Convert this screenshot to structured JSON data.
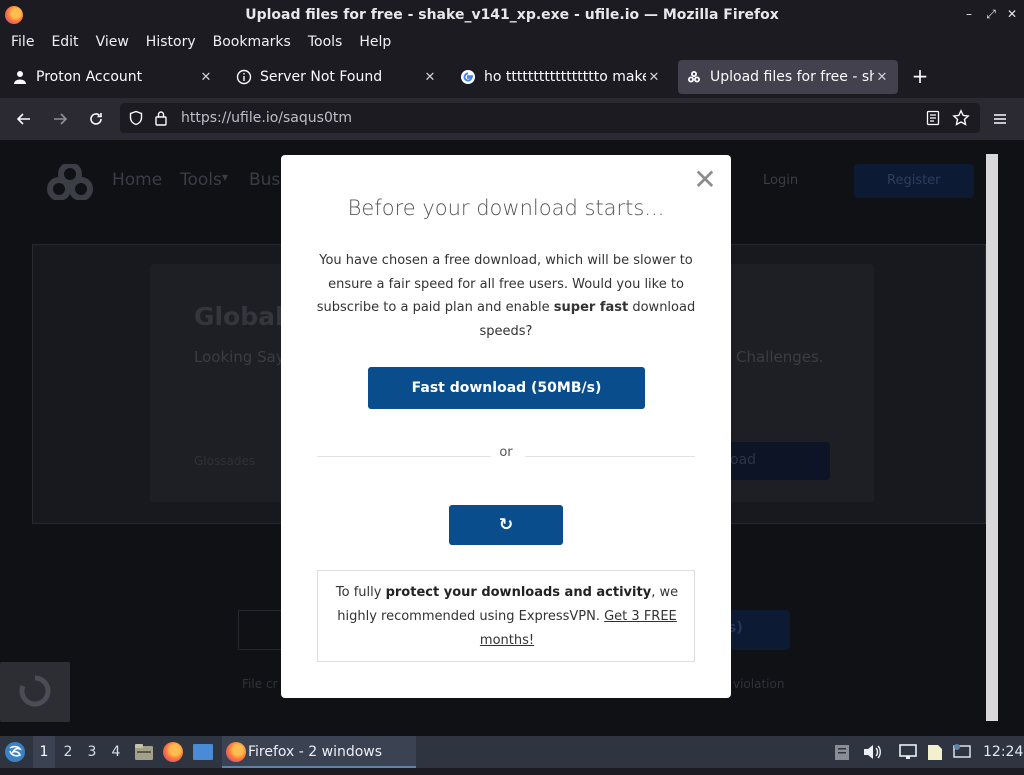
{
  "window": {
    "title": "Upload files for free - shake_v141_xp.exe - ufile.io — Mozilla Firefox",
    "controls": [
      "–",
      "⤢",
      "✕"
    ]
  },
  "menu": [
    "File",
    "Edit",
    "View",
    "History",
    "Bookmarks",
    "Tools",
    "Help"
  ],
  "tabs": [
    {
      "label": "Proton Account",
      "icon": "person-icon",
      "active": false
    },
    {
      "label": "Server Not Found",
      "icon": "info-icon",
      "active": false
    },
    {
      "label": "ho ttttttttttttttttto make",
      "icon": "google-icon",
      "active": false
    },
    {
      "label": "Upload files for free - sha",
      "icon": "ufile-icon",
      "active": true
    }
  ],
  "newtab_label": "+",
  "navbar": {
    "url_host": "https://ufile.io",
    "url_path": "/saqus0tm"
  },
  "site": {
    "nav": [
      "Home",
      "Tools",
      "Bus"
    ],
    "login": "Login",
    "register": "Register",
    "hero_title": "Global",
    "hero_sub_left": "Looking Say",
    "hero_sub_right": "Challenges.",
    "hero_btn": "oad",
    "hero_foot": "Glossades",
    "bottom_btn": "s)",
    "footer_left": "File cr",
    "footer_right": "violation"
  },
  "modal": {
    "title": "Before your download starts...",
    "desc_1": "You have chosen a free download, which will be slower to ensure a fair speed for all free users. Would you like to subscribe to a paid plan and enable ",
    "desc_bold": "super fast",
    "desc_2": " download speeds?",
    "fast_button": "Fast download (50MB/s)",
    "or_text": "or",
    "reload_icon": "↻",
    "vpn_1": "To fully ",
    "vpn_bold": "protect your downloads and activity",
    "vpn_2": ", we highly recommended using ExpressVPN. ",
    "vpn_link": "Get 3 FREE months!",
    "close": "✕"
  },
  "taskbar": {
    "workspaces": [
      "1",
      "2",
      "3",
      "4"
    ],
    "active_workspace": "1",
    "task_label": "Firefox - 2 windows",
    "clock": "12:24"
  }
}
